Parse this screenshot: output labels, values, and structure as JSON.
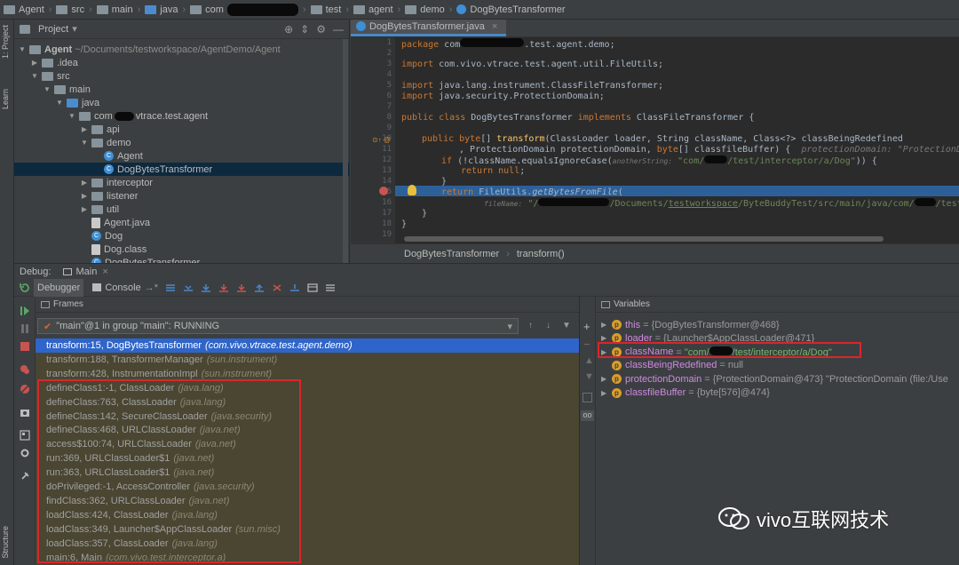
{
  "breadcrumb": {
    "items": [
      "Agent",
      "src",
      "main",
      "java",
      "com",
      "test",
      "agent",
      "demo",
      "DogBytesTransformer"
    ]
  },
  "left_stripe": {
    "tabs": [
      "1: Project",
      "Learn",
      "Structure"
    ]
  },
  "project": {
    "title": "Project",
    "dropdown_arrow": "▾",
    "tree": [
      {
        "label": "Agent ~/Documents/testworkspace/AgentDemo/Agent",
        "level": 0,
        "kind": "folder",
        "expanded": true,
        "bold_prefix": "Agent"
      },
      {
        "label": ".idea",
        "level": 1,
        "kind": "folder",
        "expanded": false
      },
      {
        "label": "src",
        "level": 1,
        "kind": "folder",
        "expanded": true
      },
      {
        "label": "main",
        "level": 2,
        "kind": "folder",
        "expanded": true
      },
      {
        "label": "java",
        "level": 3,
        "kind": "src",
        "expanded": true
      },
      {
        "label": "com",
        "suffix": "vtrace.test.agent",
        "level": 4,
        "kind": "pkg",
        "expanded": true,
        "redacted": true
      },
      {
        "label": "api",
        "level": 5,
        "kind": "pkg",
        "expanded": false
      },
      {
        "label": "demo",
        "level": 5,
        "kind": "pkg",
        "expanded": true
      },
      {
        "label": "Agent",
        "level": 6,
        "kind": "class"
      },
      {
        "label": "DogBytesTransformer",
        "level": 6,
        "kind": "class",
        "selected": true
      },
      {
        "label": "interceptor",
        "level": 5,
        "kind": "pkg",
        "expanded": false
      },
      {
        "label": "listener",
        "level": 5,
        "kind": "pkg",
        "expanded": false
      },
      {
        "label": "util",
        "level": 5,
        "kind": "pkg",
        "expanded": false
      },
      {
        "label": "Agent.java",
        "level": 5,
        "kind": "java"
      },
      {
        "label": "Dog",
        "level": 5,
        "kind": "class"
      },
      {
        "label": "Dog.class",
        "level": 5,
        "kind": "java"
      },
      {
        "label": "DogBytesTransformer",
        "level": 5,
        "kind": "class"
      }
    ]
  },
  "editor": {
    "tab_label": "DogBytesTransformer.java",
    "tab_close": "×",
    "line_numbers": [
      "1",
      "2",
      "3",
      "4",
      "5",
      "6",
      "7",
      "8",
      "9",
      "10",
      "11",
      "12",
      "13",
      "14",
      "15",
      "16",
      "17",
      "18",
      "19"
    ],
    "lines": {
      "l1_kw": "package",
      "l1_rest": " com",
      "l1_tail": ".test.agent.demo;",
      "l3_kw": "import",
      "l3_rest": " com.vivo.vtrace.test.agent.util.FileUtils;",
      "l5_kw": "import",
      "l5_rest": " java.lang.instrument.ClassFileTransformer;",
      "l6_kw": "import",
      "l6_rest": " java.security.ProtectionDomain;",
      "l8_kw": "public class",
      "l8_rest": " DogBytesTransformer ",
      "l8_kw2": "implements",
      "l8_tail": " ClassFileTransformer {",
      "l10_kw": "public byte",
      "l10_rest": "[] ",
      "l10_meth": "transform",
      "l10_tail": "(ClassLoader loader, String className, Class<?> classBeingRedefined",
      "l11_rest": ", ProtectionDomain protectionDomain, ",
      "l11_kw": "byte",
      "l11_tail": "[] classfileBuffer) {",
      "l11_hint": "protectionDomain: \"ProtectionDomain",
      "l12_kw": "if",
      "l12_rest": " (!className.equalsIgnoreCase(",
      "l12_hint": "anotherString:",
      "l12_str": "\"com/",
      "l12_str2": "/test/interceptor/a/Dog\"",
      "l12_tail": ")) {",
      "l13_kw": "return null",
      "l13_tail": ";",
      "l14_text": "}",
      "l15_kw": "return",
      "l15_rest": " FileUtils.",
      "l15_meth": "getBytesFromFile",
      "l15_tail": "(",
      "l16_hint": "fileName:",
      "l16_str": "\"/",
      "l16_str2": "/Documents/",
      "l16_str3": "testworkspace",
      "l16_str4": "/ByteBuddyTest/src/main/java/com/",
      "l16_str5": "/test/inter",
      "l17_text": "}",
      "l18_text": "}"
    },
    "status_breadcrumb": [
      "DogBytesTransformer",
      "transform()"
    ]
  },
  "debug": {
    "title_label": "Debug:",
    "session": "Main",
    "tabs": [
      "Debugger",
      "Console"
    ],
    "frames_header": "Frames",
    "variables_header": "Variables",
    "thread": "\"main\"@1 in group \"main\": RUNNING",
    "frames": [
      {
        "method": "transform:15, DogBytesTransformer",
        "pkg": "(com.vivo.vtrace.test.agent.demo)",
        "state": "sel"
      },
      {
        "method": "transform:188, TransformerManager",
        "pkg": "(sun.instrument)",
        "state": "lib"
      },
      {
        "method": "transform:428, InstrumentationImpl",
        "pkg": "(sun.instrument)",
        "state": "lib"
      },
      {
        "method": "defineClass1:-1, ClassLoader",
        "pkg": "(java.lang)",
        "state": "lib"
      },
      {
        "method": "defineClass:763, ClassLoader",
        "pkg": "(java.lang)",
        "state": "lib"
      },
      {
        "method": "defineClass:142, SecureClassLoader",
        "pkg": "(java.security)",
        "state": "lib"
      },
      {
        "method": "defineClass:468, URLClassLoader",
        "pkg": "(java.net)",
        "state": "lib"
      },
      {
        "method": "access$100:74, URLClassLoader",
        "pkg": "(java.net)",
        "state": "lib"
      },
      {
        "method": "run:369, URLClassLoader$1",
        "pkg": "(java.net)",
        "state": "lib"
      },
      {
        "method": "run:363, URLClassLoader$1",
        "pkg": "(java.net)",
        "state": "lib"
      },
      {
        "method": "doPrivileged:-1, AccessController",
        "pkg": "(java.security)",
        "state": "lib"
      },
      {
        "method": "findClass:362, URLClassLoader",
        "pkg": "(java.net)",
        "state": "lib"
      },
      {
        "method": "loadClass:424, ClassLoader",
        "pkg": "(java.lang)",
        "state": "lib"
      },
      {
        "method": "loadClass:349, Launcher$AppClassLoader",
        "pkg": "(sun.misc)",
        "state": "lib"
      },
      {
        "method": "loadClass:357, ClassLoader",
        "pkg": "(java.lang)",
        "state": "lib"
      },
      {
        "method": "main:6, Main",
        "pkg": "(com.vivo.test.interceptor.a)",
        "state": "lib"
      }
    ],
    "variables": [
      {
        "name": "this",
        "value": "= {DogBytesTransformer@468}",
        "expandable": true,
        "icon": "p"
      },
      {
        "name": "loader",
        "value": "= {Launcher$AppClassLoader@471}",
        "expandable": true,
        "icon": "p"
      },
      {
        "name": "className",
        "value_prefix": "= ",
        "string": "\"com/",
        "string2": "/test/interceptor/a/Dog\"",
        "expandable": true,
        "icon": "p",
        "highlighted": true
      },
      {
        "name": "classBeingRedefined",
        "value": "= null",
        "expandable": false,
        "icon": "p"
      },
      {
        "name": "protectionDomain",
        "value": "= {ProtectionDomain@473} \"ProtectionDomain  (file:/Use",
        "expandable": true,
        "icon": "p"
      },
      {
        "name": "classfileBuffer",
        "value": "= {byte[576]@474}",
        "expandable": true,
        "icon": "p"
      }
    ]
  },
  "watermark": {
    "text": "vivo互联网技术"
  },
  "colors": {
    "background": "#3c3f41",
    "editor_bg": "#2b2b2b",
    "selection_blue": "#2f65ca",
    "highlight_red": "#d9262b",
    "keyword": "#cc7832",
    "string": "#6a8759"
  }
}
